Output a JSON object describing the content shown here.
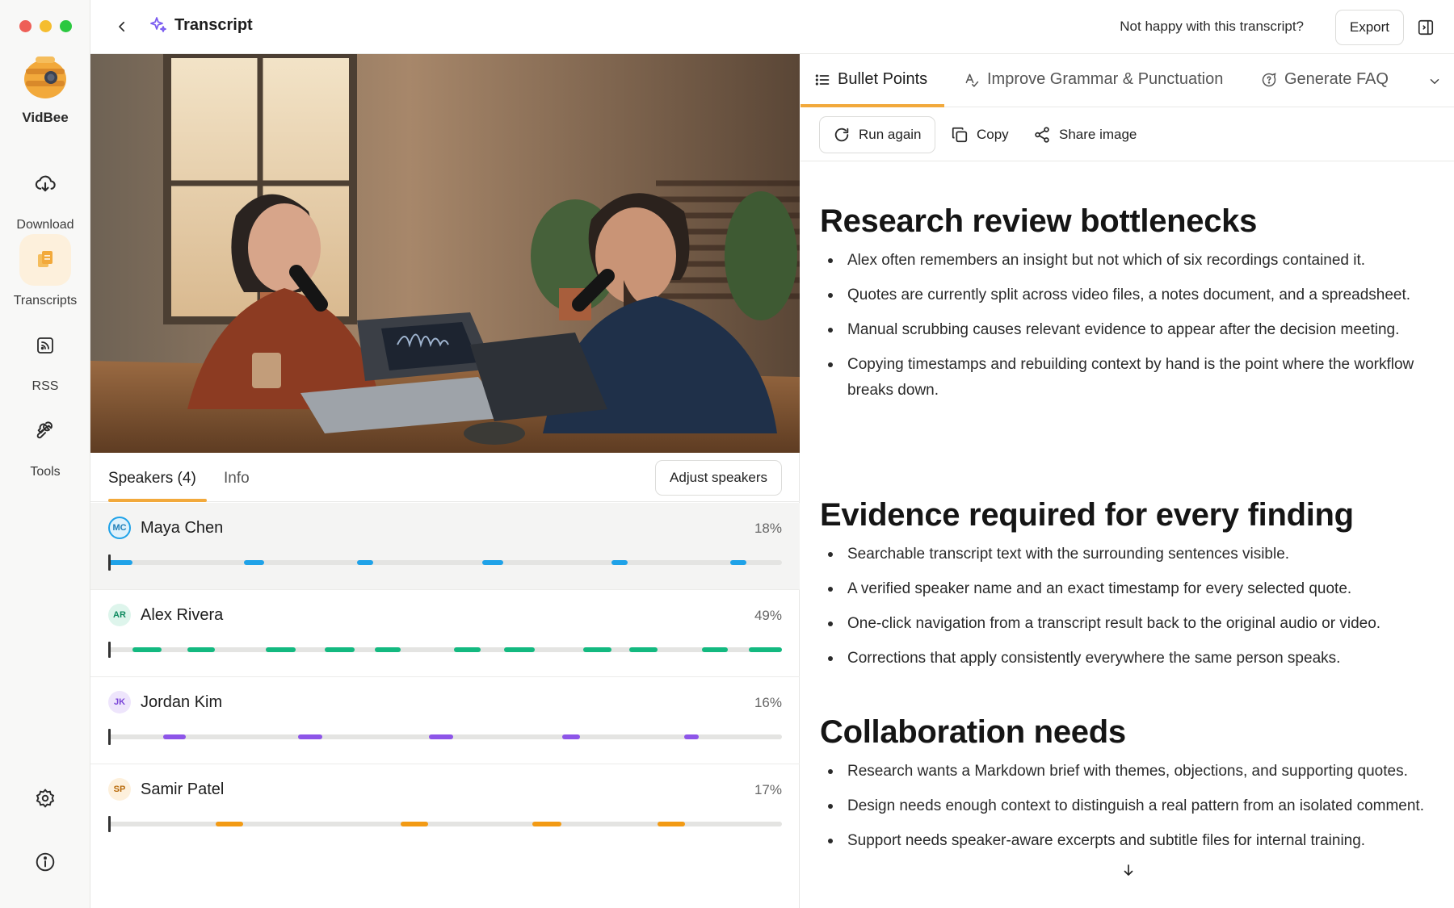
{
  "app": {
    "brand": "VidBee"
  },
  "sidebar": {
    "items": [
      {
        "label": "Download",
        "icon": "cloud-download-icon"
      },
      {
        "label": "Transcripts",
        "icon": "transcripts-icon"
      },
      {
        "label": "RSS",
        "icon": "rss-icon"
      },
      {
        "label": "Tools",
        "icon": "wrench-icon"
      }
    ],
    "bottom": [
      "settings-icon",
      "info-icon"
    ]
  },
  "header": {
    "title": "Transcript",
    "unhappy_link": "Not happy with this transcript?",
    "export_label": "Export"
  },
  "speakers_panel": {
    "tabs": [
      "Speakers (4)",
      "Info"
    ],
    "adjust_label": "Adjust speakers",
    "speakers": [
      {
        "initials": "MC",
        "name": "Maya Chen",
        "percent": "18%",
        "color": "#1fa2e8"
      },
      {
        "initials": "AR",
        "name": "Alex Rivera",
        "percent": "49%",
        "color": "#13b980"
      },
      {
        "initials": "JK",
        "name": "Jordan Kim",
        "percent": "16%",
        "color": "#8d55e8"
      },
      {
        "initials": "SP",
        "name": "Samir Patel",
        "percent": "17%",
        "color": "#f29a14"
      }
    ]
  },
  "right_panel": {
    "tabs": [
      "Bullet Points",
      "Improve Grammar & Punctuation",
      "Generate FAQ"
    ],
    "toolbar": {
      "run_again": "Run again",
      "copy": "Copy",
      "share_image": "Share image"
    },
    "sections": [
      {
        "heading": "Research review bottlenecks",
        "bullets": [
          "Alex often remembers an insight but not which of six recordings contained it.",
          "Quotes are currently split across video files, a notes document, and a spreadsheet.",
          "Manual scrubbing causes relevant evidence to appear after the decision meeting.",
          "Copying timestamps and rebuilding context by hand is the point where the workflow breaks down."
        ]
      },
      {
        "heading": "Evidence required for every finding",
        "bullets": [
          "Searchable transcript text with the surrounding sentences visible.",
          "A verified speaker name and an exact timestamp for every selected quote.",
          "One-click navigation from a transcript result back to the original audio or video.",
          "Corrections that apply consistently everywhere the same person speaks."
        ]
      },
      {
        "heading": "Collaboration needs",
        "bullets": [
          "Research wants a Markdown brief with themes, objections, and supporting quotes.",
          "Design needs enough context to distinguish a real pattern from an isolated comment.",
          "Support needs speaker-aware excerpts and subtitle files for internal training."
        ]
      }
    ]
  },
  "colors": {
    "accent": "#f2a93b"
  }
}
